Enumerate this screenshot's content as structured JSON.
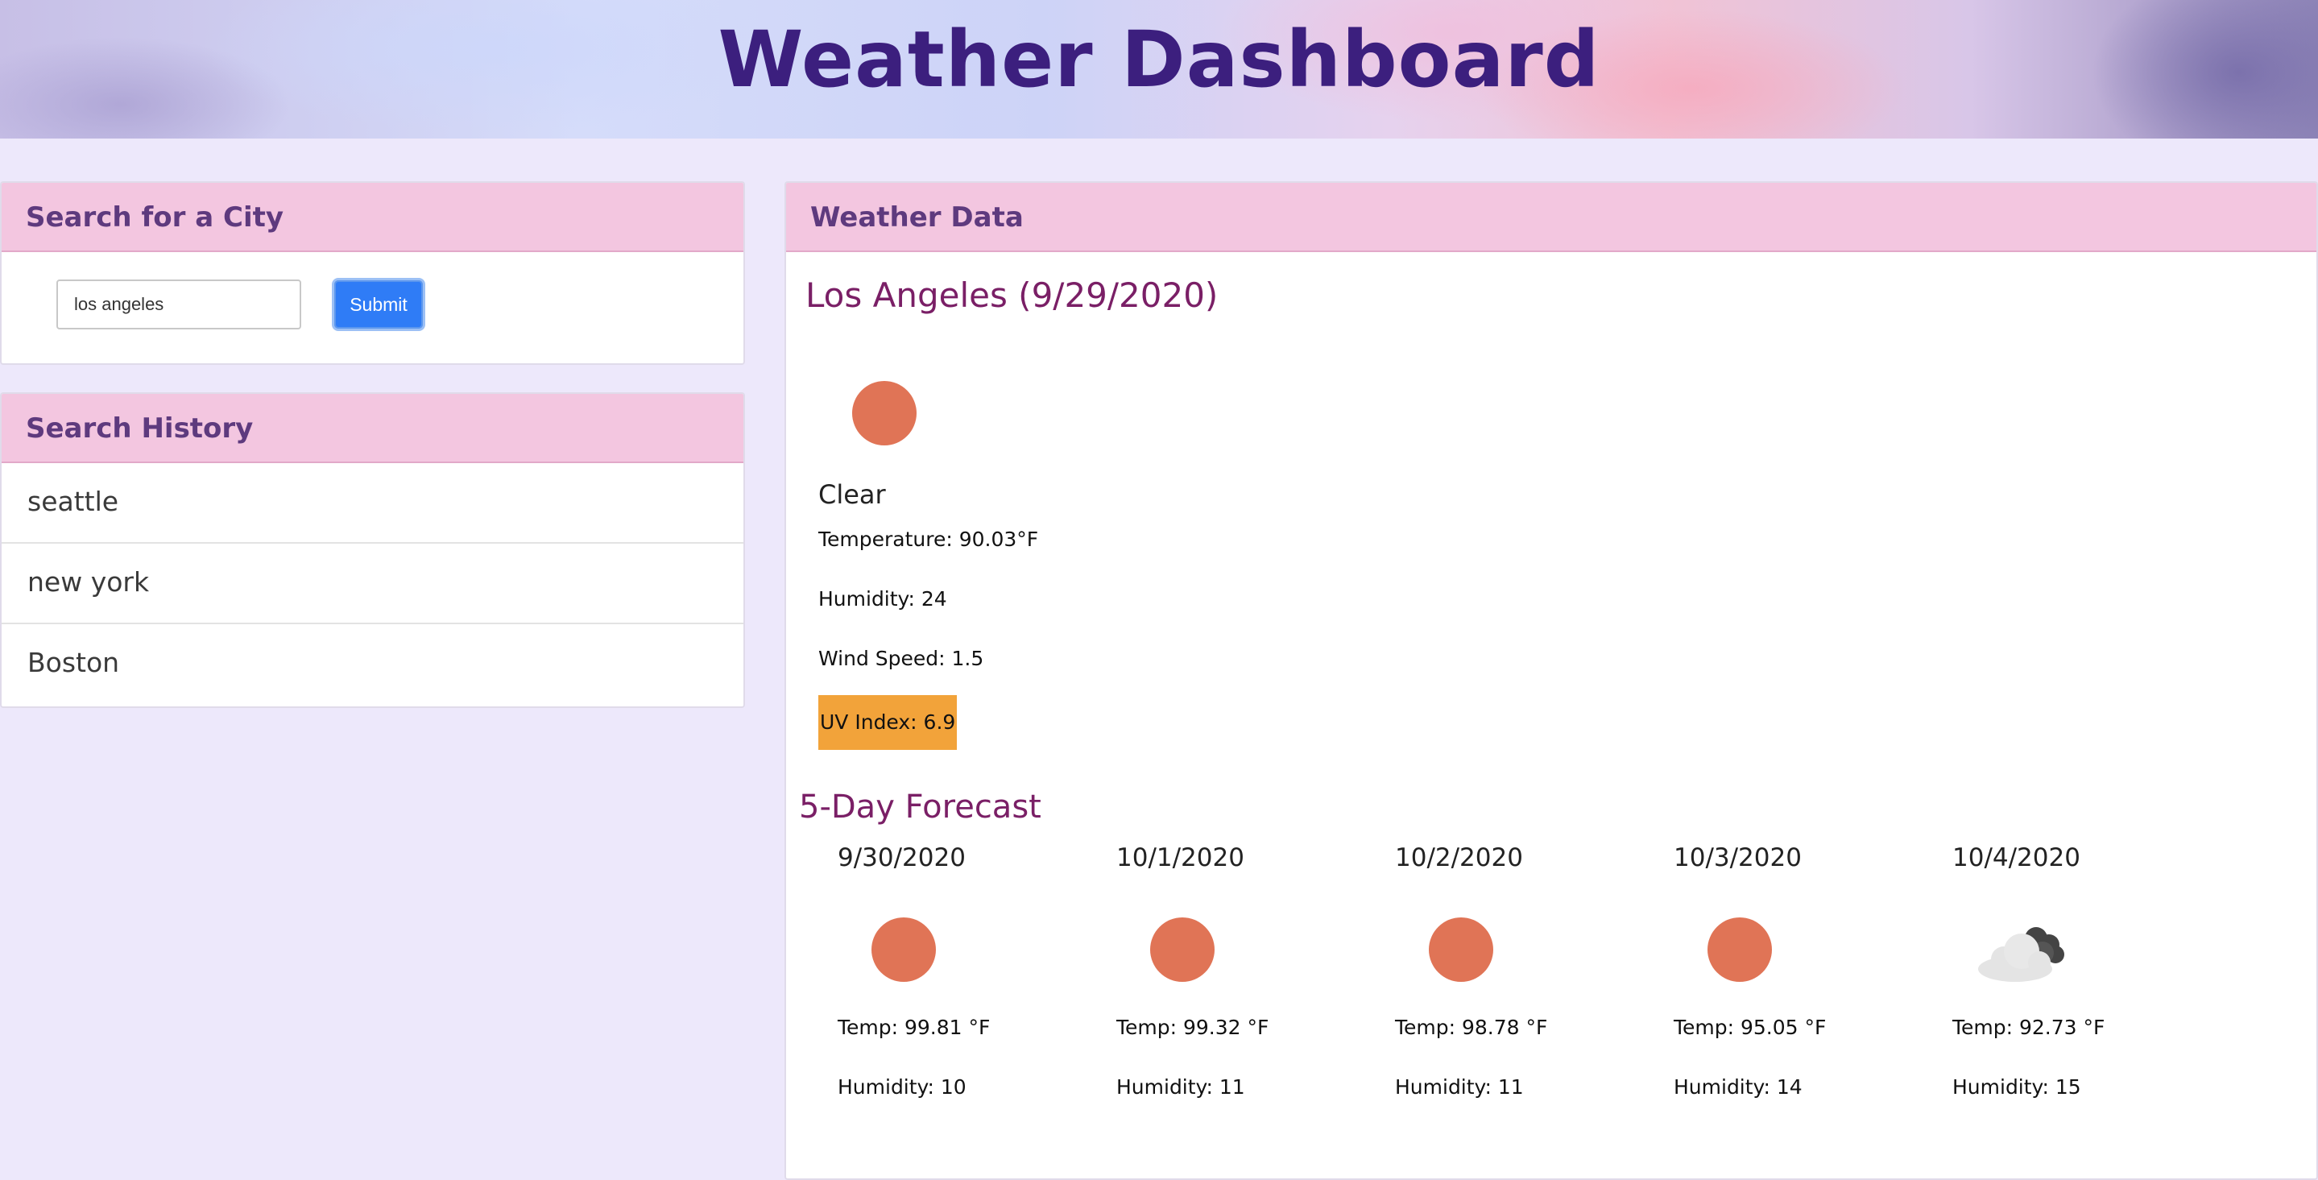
{
  "header": {
    "title": "Weather Dashboard"
  },
  "search": {
    "title": "Search for a City",
    "input_value": "los angeles",
    "submit_label": "Submit"
  },
  "history": {
    "title": "Search History",
    "items": [
      "seattle",
      "new york",
      "Boston"
    ]
  },
  "weather": {
    "title": "Weather Data",
    "city_heading": "Los Angeles (9/29/2020)",
    "icon": "sun-icon",
    "description": "Clear",
    "temperature": "Temperature: 90.03°F",
    "humidity": "Humidity: 24",
    "wind": "Wind Speed: 1.5",
    "uv": "UV Index: 6.9",
    "uv_color": "#f2a33a"
  },
  "forecast": {
    "title": "5-Day Forecast",
    "days": [
      {
        "date": "9/30/2020",
        "icon": "sun-icon",
        "temp": "Temp: 99.81 °F",
        "humidity": "Humidity: 10"
      },
      {
        "date": "10/1/2020",
        "icon": "sun-icon",
        "temp": "Temp: 99.32 °F",
        "humidity": "Humidity: 11"
      },
      {
        "date": "10/2/2020",
        "icon": "sun-icon",
        "temp": "Temp: 98.78 °F",
        "humidity": "Humidity: 11"
      },
      {
        "date": "10/3/2020",
        "icon": "sun-icon",
        "temp": "Temp: 95.05 °F",
        "humidity": "Humidity: 14"
      },
      {
        "date": "10/4/2020",
        "icon": "cloud-icon",
        "temp": "Temp: 92.73 °F",
        "humidity": "Humidity: 15"
      }
    ]
  },
  "colors": {
    "accent_header": "#3c1f7e",
    "card_header_bg": "#f3c6e0",
    "city_text": "#7a1f66",
    "button": "#2f7cf6",
    "sun": "#e07456"
  }
}
